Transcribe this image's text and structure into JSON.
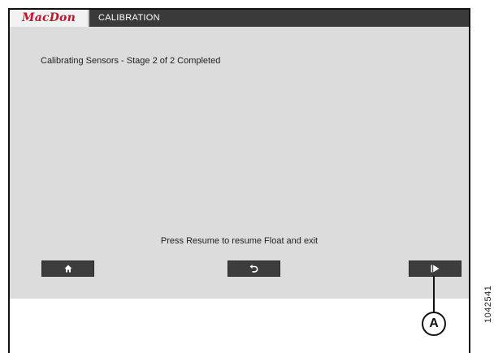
{
  "header": {
    "brand": "MacDon",
    "title": "CALIBRATION"
  },
  "main": {
    "status": "Calibrating Sensors - Stage 2 of 2 Completed",
    "instruction": "Press Resume to resume Float and exit"
  },
  "buttons": {
    "home_icon": "home-icon",
    "back_icon": "back-arrow-icon",
    "resume_icon": "play-icon"
  },
  "annotation": {
    "callout_label": "A",
    "figure_number": "1042541"
  },
  "colors": {
    "brand_red": "#c8102e",
    "header_bg": "#3a3a3a",
    "screen_bg": "#dcdcdc",
    "button_bg": "#3d3d3d"
  }
}
